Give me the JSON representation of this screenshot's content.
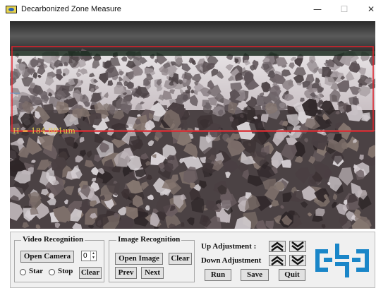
{
  "window": {
    "title": "Decarbonized Zone Measure",
    "minimize_glyph": "—",
    "maximize_glyph": "☐",
    "close_glyph": "✕"
  },
  "image_view": {
    "measurement_label": "H = 184.881um",
    "colors": {
      "mount_dark": "#3a3a3a",
      "ferrite_light": "#e9e3e8",
      "pearlite_dark": "#3e3334",
      "roi_box": "#e0202a",
      "measurement_line": "#d44040",
      "label_color": "#e6d050"
    }
  },
  "video_recognition": {
    "title": "Video Recognition",
    "open_camera": "Open Camera",
    "camera_index": "0",
    "spin_up": "▲",
    "spin_down": "▼",
    "start_label": "Star",
    "stop_label": "Stop",
    "clear": "Clear"
  },
  "image_recognition": {
    "title": "Image Recognition",
    "open_image": "Open Image",
    "clear": "Clear",
    "prev": "Prev",
    "next": "Next"
  },
  "adjustment": {
    "up_label": "Up Adjustment :",
    "down_label": "Down Adjustment",
    "run": "Run",
    "save": "Save",
    "quit": "Quit"
  },
  "logo": {
    "icon": "logo-icon",
    "color": "#1a86c8"
  }
}
